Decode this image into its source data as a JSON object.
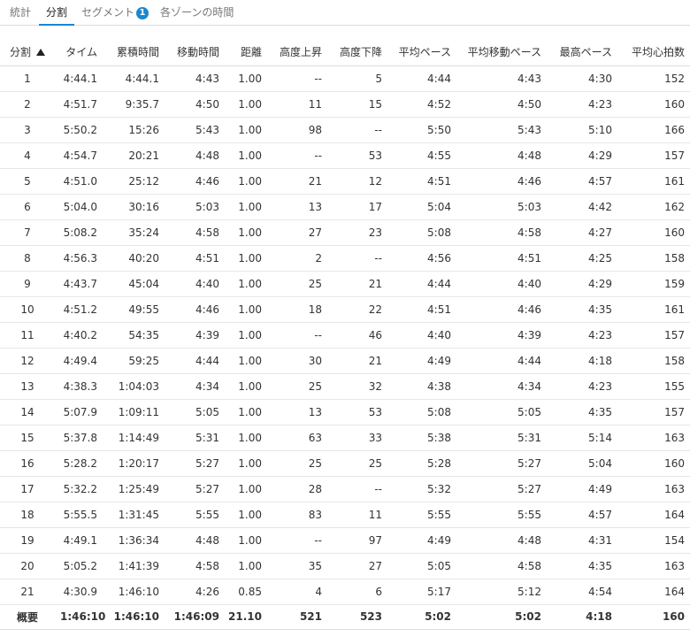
{
  "tabs": [
    {
      "label": "統計",
      "active": false
    },
    {
      "label": "分割",
      "active": true
    },
    {
      "label": "セグメント",
      "active": false,
      "badge": "1"
    },
    {
      "label": "各ゾーンの時間",
      "active": false
    }
  ],
  "columns": [
    "分割",
    "タイム",
    "累積時間",
    "移動時間",
    "距離",
    "高度上昇",
    "高度下降",
    "平均ペース",
    "平均移動ペース",
    "最高ペース",
    "平均心拍数"
  ],
  "sort": {
    "column": "分割",
    "direction": "ascending"
  },
  "rows": [
    [
      "1",
      "4:44.1",
      "4:44.1",
      "4:43",
      "1.00",
      "--",
      "5",
      "4:44",
      "4:43",
      "4:30",
      "152"
    ],
    [
      "2",
      "4:51.7",
      "9:35.7",
      "4:50",
      "1.00",
      "11",
      "15",
      "4:52",
      "4:50",
      "4:23",
      "160"
    ],
    [
      "3",
      "5:50.2",
      "15:26",
      "5:43",
      "1.00",
      "98",
      "--",
      "5:50",
      "5:43",
      "5:10",
      "166"
    ],
    [
      "4",
      "4:54.7",
      "20:21",
      "4:48",
      "1.00",
      "--",
      "53",
      "4:55",
      "4:48",
      "4:29",
      "157"
    ],
    [
      "5",
      "4:51.0",
      "25:12",
      "4:46",
      "1.00",
      "21",
      "12",
      "4:51",
      "4:46",
      "4:57",
      "161"
    ],
    [
      "6",
      "5:04.0",
      "30:16",
      "5:03",
      "1.00",
      "13",
      "17",
      "5:04",
      "5:03",
      "4:42",
      "162"
    ],
    [
      "7",
      "5:08.2",
      "35:24",
      "4:58",
      "1.00",
      "27",
      "23",
      "5:08",
      "4:58",
      "4:27",
      "160"
    ],
    [
      "8",
      "4:56.3",
      "40:20",
      "4:51",
      "1.00",
      "2",
      "--",
      "4:56",
      "4:51",
      "4:25",
      "158"
    ],
    [
      "9",
      "4:43.7",
      "45:04",
      "4:40",
      "1.00",
      "25",
      "21",
      "4:44",
      "4:40",
      "4:29",
      "159"
    ],
    [
      "10",
      "4:51.2",
      "49:55",
      "4:46",
      "1.00",
      "18",
      "22",
      "4:51",
      "4:46",
      "4:35",
      "161"
    ],
    [
      "11",
      "4:40.2",
      "54:35",
      "4:39",
      "1.00",
      "--",
      "46",
      "4:40",
      "4:39",
      "4:23",
      "157"
    ],
    [
      "12",
      "4:49.4",
      "59:25",
      "4:44",
      "1.00",
      "30",
      "21",
      "4:49",
      "4:44",
      "4:18",
      "158"
    ],
    [
      "13",
      "4:38.3",
      "1:04:03",
      "4:34",
      "1.00",
      "25",
      "32",
      "4:38",
      "4:34",
      "4:23",
      "155"
    ],
    [
      "14",
      "5:07.9",
      "1:09:11",
      "5:05",
      "1.00",
      "13",
      "53",
      "5:08",
      "5:05",
      "4:35",
      "157"
    ],
    [
      "15",
      "5:37.8",
      "1:14:49",
      "5:31",
      "1.00",
      "63",
      "33",
      "5:38",
      "5:31",
      "5:14",
      "163"
    ],
    [
      "16",
      "5:28.2",
      "1:20:17",
      "5:27",
      "1.00",
      "25",
      "25",
      "5:28",
      "5:27",
      "5:04",
      "160"
    ],
    [
      "17",
      "5:32.2",
      "1:25:49",
      "5:27",
      "1.00",
      "28",
      "--",
      "5:32",
      "5:27",
      "4:49",
      "163"
    ],
    [
      "18",
      "5:55.5",
      "1:31:45",
      "5:55",
      "1.00",
      "83",
      "11",
      "5:55",
      "5:55",
      "4:57",
      "164"
    ],
    [
      "19",
      "4:49.1",
      "1:36:34",
      "4:48",
      "1.00",
      "--",
      "97",
      "4:49",
      "4:48",
      "4:31",
      "154"
    ],
    [
      "20",
      "5:05.2",
      "1:41:39",
      "4:58",
      "1.00",
      "35",
      "27",
      "5:05",
      "4:58",
      "4:35",
      "163"
    ],
    [
      "21",
      "4:30.9",
      "1:46:10",
      "4:26",
      "0.85",
      "4",
      "6",
      "5:17",
      "5:12",
      "4:54",
      "164"
    ]
  ],
  "summary": [
    "概要",
    "1:46:10",
    "1:46:10",
    "1:46:09",
    "21.10",
    "521",
    "523",
    "5:02",
    "5:02",
    "4:18",
    "160"
  ]
}
